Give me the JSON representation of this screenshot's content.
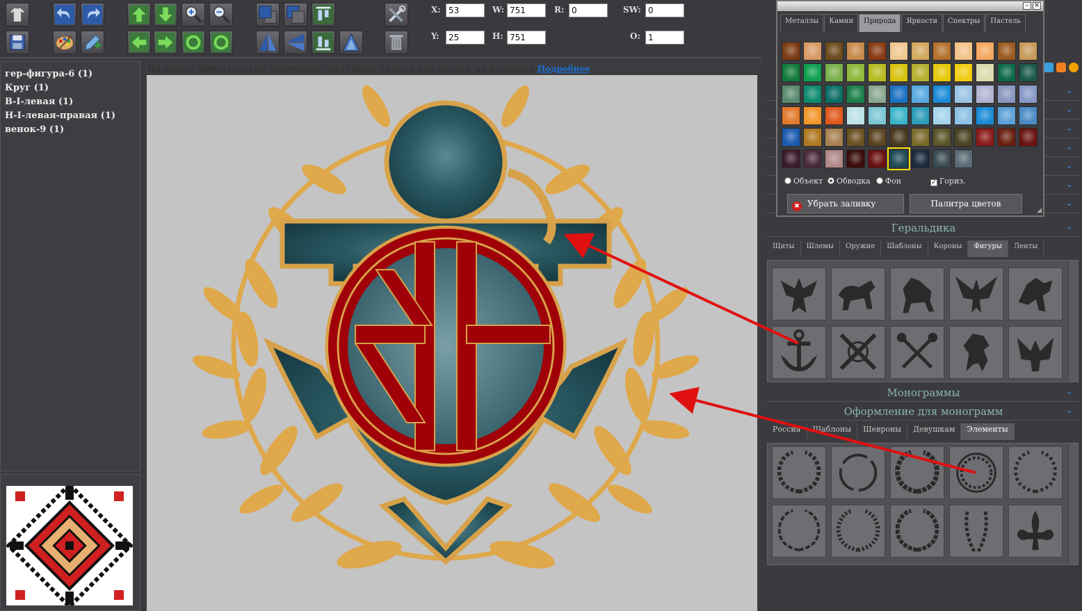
{
  "toolbar": {
    "fields": {
      "x_label": "X:",
      "x_value": "53",
      "y_label": "Y:",
      "y_value": "25",
      "w_label": "W:",
      "w_value": "751",
      "h_label": "H:",
      "h_value": "751",
      "r_label": "R:",
      "r_value": "0",
      "sw_label": "SW:",
      "sw_value": "0",
      "o_label": "O:",
      "o_value": "1"
    }
  },
  "layers": {
    "items": [
      "гер-фигура-6 (1)",
      "Круг (1)",
      "В-I-левая (1)",
      "Н-I-левая-правая (1)",
      "венок-9 (1)"
    ]
  },
  "canvas": {
    "notice_text": "На холсте присутствуют элементы, доступные только для печати на изделиях",
    "notice_link": "Подробнее"
  },
  "palette": {
    "tabs": [
      "Металлы",
      "Камни",
      "Природа",
      "Яркости",
      "Спектры",
      "Пастель"
    ],
    "active_tab": "Природа",
    "radio_object": "Объект",
    "radio_stroke": "Обводка",
    "radio_background": "Фон",
    "checkbox_horizontal": "Гориз.",
    "remove_fill_button": "Убрать заливку",
    "color_palette_button": "Палитра цветов",
    "selected_swatch_color": "#1f4a55",
    "swatch_colors": [
      [
        "#7a3b12",
        "#d89a66",
        "#6d4a1c",
        "#c68a4a",
        "#8a3a14",
        "#f0c890",
        "#d4a860",
        "#b5702e",
        "#f2c38a",
        "#f4a860",
        "#9a5a20",
        "#c79a5a"
      ],
      [
        "#127a3a",
        "#0fa050",
        "#7ab04a",
        "#8cb83a",
        "#b6bc20",
        "#d6c20e",
        "#b5b030",
        "#e4c808",
        "#f2cc10",
        "#dadcae",
        "#0d6a4a",
        "#1a5a48"
      ],
      [
        "#5a8a70",
        "#0c8a6e",
        "#0a6e64",
        "#1a7e4a",
        "#8aa890",
        "#1a70c0",
        "#56a8e0",
        "#1a8ad6",
        "#9ac4e4",
        "#b0b4d2",
        "#8a96c0",
        "#8898c8"
      ],
      [
        "#e0782a",
        "#f2962a",
        "#e0581a",
        "#bce2e8",
        "#7ac6d4",
        "#3ab4c8",
        "#2a9ab8",
        "#a4d4ec",
        "#8cc0e4",
        "#1a8ad6",
        "#5aa0d8",
        "#4a8ac4"
      ],
      [
        "#1a5ab0",
        "#b07820",
        "#a88050",
        "#6a5020",
        "#5a4420",
        "#4a3a22",
        "#7a6a2a",
        "#5a5428",
        "#4a4424",
        "#8a1a18",
        "#6a2010",
        "#6a1410"
      ],
      [
        "#3a1a2a",
        "#4a2a3a",
        "#b08888",
        "#3a0c0c",
        "#6a1010",
        "#1f4a55",
        "#1a2a3a",
        "#3a4a50",
        "#5a6a74"
      ]
    ]
  },
  "heraldry": {
    "title": "Геральдика",
    "tabs": [
      "Щиты",
      "Шлемы",
      "Оружие",
      "Шаблоны",
      "Короны",
      "Фигуры",
      "Ленты"
    ],
    "active_tab": "Фигуры",
    "items": [
      "eagle-double-head",
      "lion-passant",
      "horse-rearing",
      "eagle-spread",
      "griffin",
      "anchor",
      "crossed-anchors",
      "crossed-keys",
      "lion-rampant",
      "eagle"
    ]
  },
  "monograms": {
    "title": "Монограммы"
  },
  "monogram_decor": {
    "title": "Оформление для монограмм",
    "tabs": [
      "Россия",
      "Шаблоны",
      "Шевроны",
      "Девушкам",
      "Элементы"
    ],
    "active_tab": "Элементы",
    "items": [
      "laurel-wreath-1",
      "laurel-wreath-2",
      "laurel-wreath-3",
      "laurel-wreath-4",
      "laurel-wreath-5",
      "laurel-wreath-6",
      "laurel-wreath-7",
      "laurel-wreath-8",
      "laurel-wreath-9",
      "fleur-de-lis"
    ]
  },
  "colors": {
    "anchor_fill": "#1f4a55",
    "anchor_stroke": "#d8a24a",
    "monogram_red": "#a00008",
    "wreath_gold": "#dfa84a",
    "canvas_bg": "#c4c4c4",
    "arrow_red": "#e01010"
  }
}
